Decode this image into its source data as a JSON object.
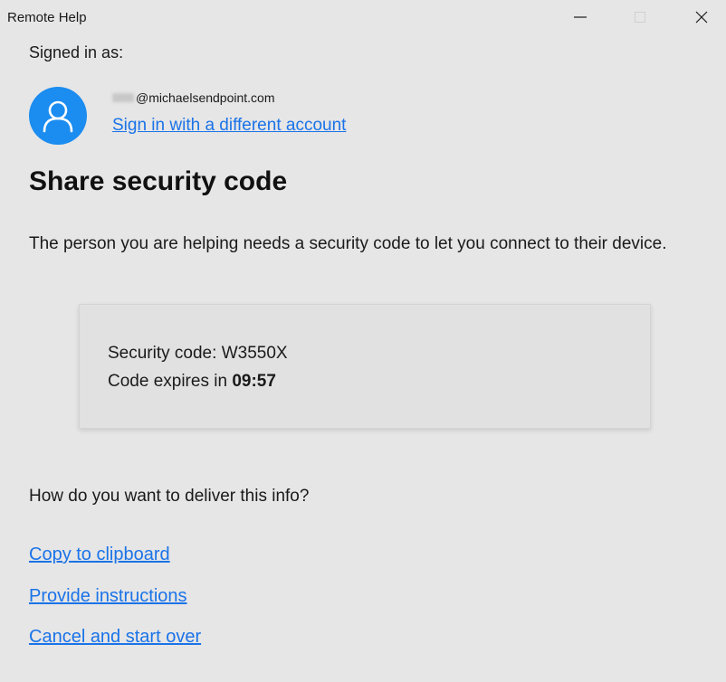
{
  "window": {
    "title": "Remote Help",
    "minimize_glyph": "—",
    "close_glyph": "✕"
  },
  "account": {
    "signed_in_label": "Signed in as:",
    "email_visible": "@michaelsendpoint.com",
    "switch_link": "Sign in with a different account",
    "avatar_icon": "person-icon",
    "avatar_color": "#1b8cf0"
  },
  "main": {
    "heading": "Share security code",
    "description": "The person you are helping needs a security code to let you connect to their device."
  },
  "code_card": {
    "code_label": "Security code:",
    "code_value": "W3550X",
    "expires_label": "Code expires in",
    "expires_value": "09:57"
  },
  "delivery": {
    "question": "How do you want to deliver this info?",
    "links": [
      "Copy to clipboard",
      "Provide instructions",
      "Cancel and start over"
    ]
  },
  "colors": {
    "background": "#e6e6e6",
    "link": "#1a73e8",
    "card_bg": "#e1e1e1"
  }
}
